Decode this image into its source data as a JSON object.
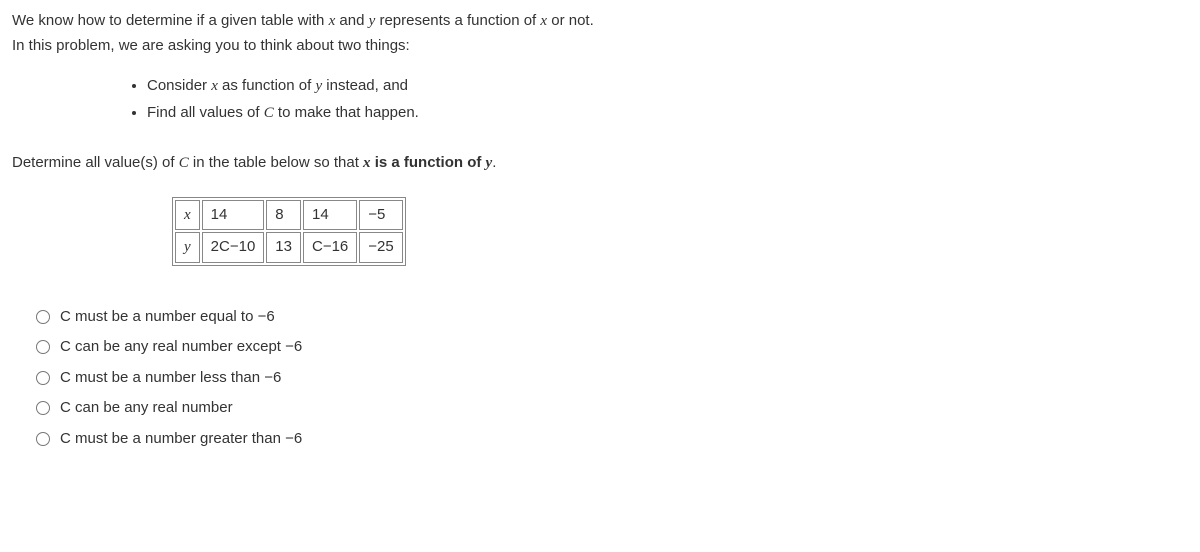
{
  "intro": {
    "line1_pre": "We know how to determine if a given table with ",
    "line1_mid1": " and ",
    "line1_mid2": " represents a function of ",
    "line1_post": " or not.",
    "line2": "In this problem, we are asking you to think about two things:",
    "var_x": "x",
    "var_y": "y"
  },
  "bullets": {
    "b1_pre": "Consider ",
    "b1_mid": " as function of ",
    "b1_post": " instead, and",
    "b2_pre": "Find all values of ",
    "b2_var": "C",
    "b2_post": " to make that happen."
  },
  "prompt": {
    "pre": "Determine all value(s) of ",
    "var_c": "C",
    "mid": " in the table below so that ",
    "bold_x": "x",
    "bold_mid": " is a function of ",
    "bold_y": "y",
    "post": "."
  },
  "table": {
    "row1_label": "x",
    "row2_label": "y",
    "r1c1": "14",
    "r1c2": "8",
    "r1c3": "14",
    "r1c4": "−5",
    "r2c1": "2C−10",
    "r2c2": "13",
    "r2c3": "C−16",
    "r2c4": "−25"
  },
  "options": {
    "o1": "C must be a number equal to −6",
    "o2": "C can be any real number except −6",
    "o3": "C must be a number less than −6",
    "o4": "C can be any real number",
    "o5": "C must be a number greater than −6"
  }
}
